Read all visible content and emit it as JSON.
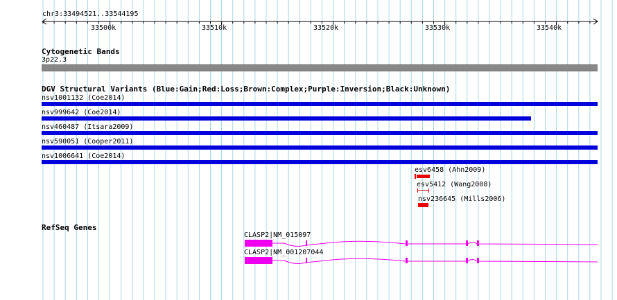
{
  "ruler": {
    "coord_label": "chr3:33494521..33544195",
    "ticks": [
      "33500k",
      "33510k",
      "33520k",
      "33530k",
      "33540k"
    ]
  },
  "cytoband": {
    "title": "Cytogenetic Bands",
    "band": "3p22.3"
  },
  "dgv": {
    "title": "DGV Structural Variants (Blue:Gain;Red:Loss;Brown:Complex;Purple:Inversion;Black:Unknown)",
    "items": [
      {
        "label": "nsv1001132 (Coe2014)",
        "type": "gain"
      },
      {
        "label": "nsv999642 (Coe2014)",
        "type": "gain"
      },
      {
        "label": "nsv460487 (Itsara2009)",
        "type": "gain"
      },
      {
        "label": "nsv590051 (Cooper2011)",
        "type": "gain"
      },
      {
        "label": "nsv1006641 (Coe2014)",
        "type": "gain"
      },
      {
        "label": "esv6458 (Ahn2009)",
        "type": "loss"
      },
      {
        "label": "esv5412 (Wang2008)",
        "type": "loss"
      },
      {
        "label": "nsv236645 (Mills2006)",
        "type": "loss"
      }
    ],
    "colors": {
      "gain": "#0000dd",
      "loss": "#ee0000"
    }
  },
  "refseq": {
    "title": "RefSeq Genes",
    "transcripts": [
      {
        "label": "CLASP2|NM_015097"
      },
      {
        "label": "CLASP2|NM_001207044"
      }
    ],
    "color": "#ee00ee"
  },
  "colors": {
    "grid": "#a8d8e8",
    "cytoband_fill": "#888888"
  }
}
